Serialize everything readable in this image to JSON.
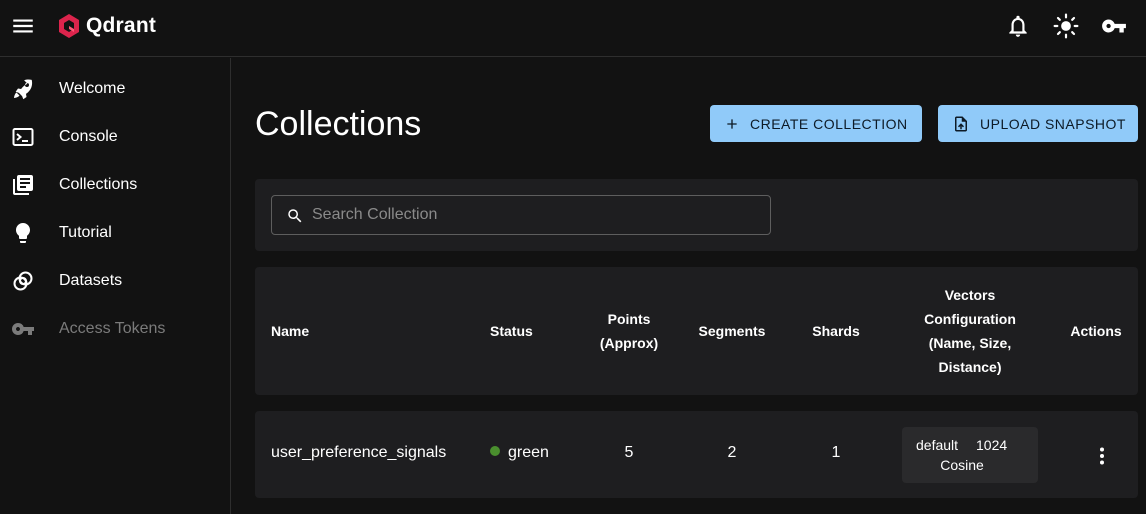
{
  "app": {
    "name": "Qdrant",
    "brand_color": "#dc244c",
    "accent": "#90caf9"
  },
  "topbar": {
    "icons": [
      "menu-icon",
      "bell-icon",
      "sun-icon",
      "key-icon"
    ]
  },
  "sidebar": {
    "items": [
      {
        "label": "Welcome",
        "icon": "rocket-icon",
        "disabled": false
      },
      {
        "label": "Console",
        "icon": "terminal-icon",
        "disabled": false
      },
      {
        "label": "Collections",
        "icon": "collections-icon",
        "disabled": false
      },
      {
        "label": "Tutorial",
        "icon": "lightbulb-icon",
        "disabled": false,
        "expandable": true
      },
      {
        "label": "Datasets",
        "icon": "datasets-icon",
        "disabled": false
      },
      {
        "label": "Access Tokens",
        "icon": "key-icon",
        "disabled": true
      }
    ]
  },
  "main": {
    "title": "Collections",
    "create_label": "CREATE COLLECTION",
    "upload_label": "UPLOAD SNAPSHOT",
    "search_placeholder": "Search Collection"
  },
  "table": {
    "columns": {
      "name": "Name",
      "status": "Status",
      "points": "Points (Approx)",
      "segments": "Segments",
      "shards": "Shards",
      "vectors": "Vectors Configuration (Name, Size, Distance)",
      "actions": "Actions"
    },
    "rows": [
      {
        "name": "user_preference_signals",
        "status": "green",
        "status_color": "#4caf50",
        "points": "5",
        "segments": "2",
        "shards": "1",
        "vector_name": "default",
        "vector_size": "1024",
        "vector_distance": "Cosine"
      }
    ]
  }
}
